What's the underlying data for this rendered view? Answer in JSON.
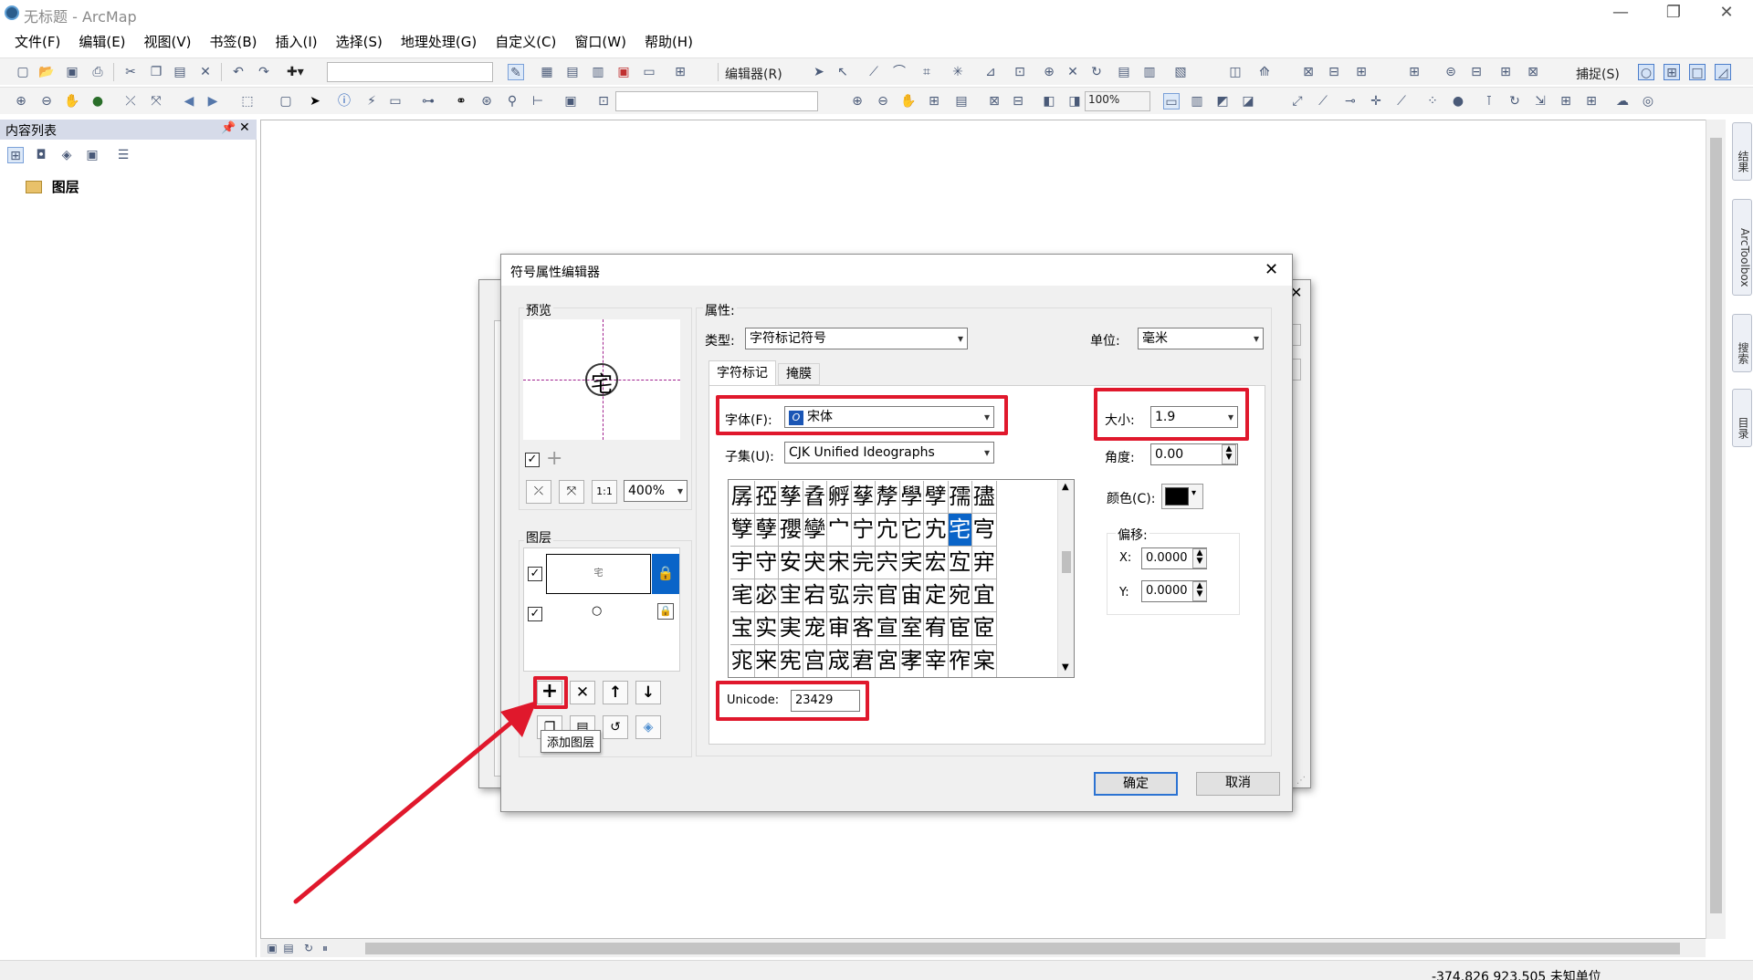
{
  "window": {
    "title": "无标题 - ArcMap"
  },
  "menu": [
    "文件(F)",
    "编辑(E)",
    "视图(V)",
    "书签(B)",
    "插入(I)",
    "选择(S)",
    "地理处理(G)",
    "自定义(C)",
    "窗口(W)",
    "帮助(H)"
  ],
  "toolbar": {
    "editor_label": "编辑器(R)",
    "snap_label": "捕捉(S)",
    "zoom_value": "100%"
  },
  "toc": {
    "title": "内容列表",
    "root_layer": "图层"
  },
  "side_tabs": [
    "结果",
    "ArcToolbox",
    "搜索",
    "目录"
  ],
  "status": {
    "coords": "-374.826  923.505 未知单位"
  },
  "dialog": {
    "title": "符号属性编辑器",
    "preview_label": "预览",
    "preview_glyph": "宅",
    "zoom": "400%",
    "layers_label": "图层",
    "layer1_glyph": "宅",
    "layer2_glyph": "○",
    "tooltip": "添加图层",
    "properties_label": "属性:",
    "type_label": "类型:",
    "type_value": "字符标记符号",
    "unit_label": "单位:",
    "unit_value": "毫米",
    "tabs": [
      "字符标记",
      "掩膜"
    ],
    "font_label": "字体(F):",
    "font_value": "宋体",
    "font_badge": "O",
    "subset_label": "子集(U):",
    "subset_value": "CJK Unified Ideographs",
    "size_label": "大小:",
    "size_value": "1.9",
    "angle_label": "角度:",
    "angle_value": "0.00",
    "color_label": "颜色(C):",
    "color_value": "#000000",
    "offset_label": "偏移:",
    "x_label": "X:",
    "x_value": "0.0000",
    "y_label": "Y:",
    "y_value": "0.0000",
    "unicode_label": "Unicode:",
    "unicode_value": "23429",
    "ok_label": "确定",
    "cancel_label": "取消",
    "glyphs": [
      "孱",
      "孲",
      "孳",
      "孴",
      "孵",
      "孶",
      "孷",
      "學",
      "孹",
      "孺",
      "孻",
      "孼",
      "孽",
      "孾",
      "孿",
      "宀",
      "宁",
      "宂",
      "它",
      "宄",
      "宅",
      "宆",
      "宇",
      "守",
      "安",
      "宊",
      "宋",
      "完",
      "宍",
      "宎",
      "宏",
      "宐",
      "宑",
      "宒",
      "宓",
      "宔",
      "宕",
      "宖",
      "宗",
      "官",
      "宙",
      "定",
      "宛",
      "宜",
      "宝",
      "实",
      "実",
      "宠",
      "审",
      "客",
      "宣",
      "室",
      "宥",
      "宦",
      "宧",
      "宨",
      "宩",
      "宪",
      "宫",
      "宬",
      "宭",
      "宮",
      "宯",
      "宰",
      "宱",
      "宲"
    ],
    "selected_index": 20
  },
  "colors": {
    "accent": "#0a64c8",
    "highlight": "#e0182c"
  }
}
